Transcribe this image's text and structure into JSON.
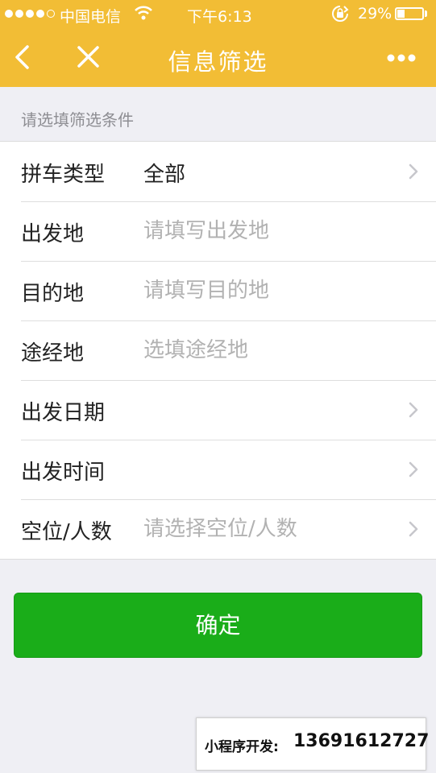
{
  "status_bar": {
    "carrier": "中国电信",
    "time": "下午6:13",
    "battery_percent": "29%",
    "battery_level": 0.29,
    "signal_bars_filled": 4,
    "signal_bars_total": 5
  },
  "nav": {
    "title": "信息筛选",
    "icons": [
      "back-icon",
      "close-icon",
      "more-icon"
    ]
  },
  "section_hint": "请选填筛选条件",
  "form": {
    "ride_type": {
      "label": "拼车类型",
      "value": "全部"
    },
    "departure": {
      "label": "出发地",
      "value": "",
      "placeholder": "请填写出发地"
    },
    "destination": {
      "label": "目的地",
      "value": "",
      "placeholder": "请填写目的地"
    },
    "via": {
      "label": "途经地",
      "value": "",
      "placeholder": "选填途经地"
    },
    "depart_date": {
      "label": "出发日期",
      "value": ""
    },
    "depart_time": {
      "label": "出发时间",
      "value": ""
    },
    "seats": {
      "label": "空位/人数",
      "placeholder": "请选择空位/人数"
    }
  },
  "confirm_label": "确定",
  "watermark": {
    "label": "小程序开发:",
    "phone": "13691612727"
  },
  "colors": {
    "header": "#f2bd35",
    "background": "#efeff4",
    "primary_button": "#1aad19"
  }
}
